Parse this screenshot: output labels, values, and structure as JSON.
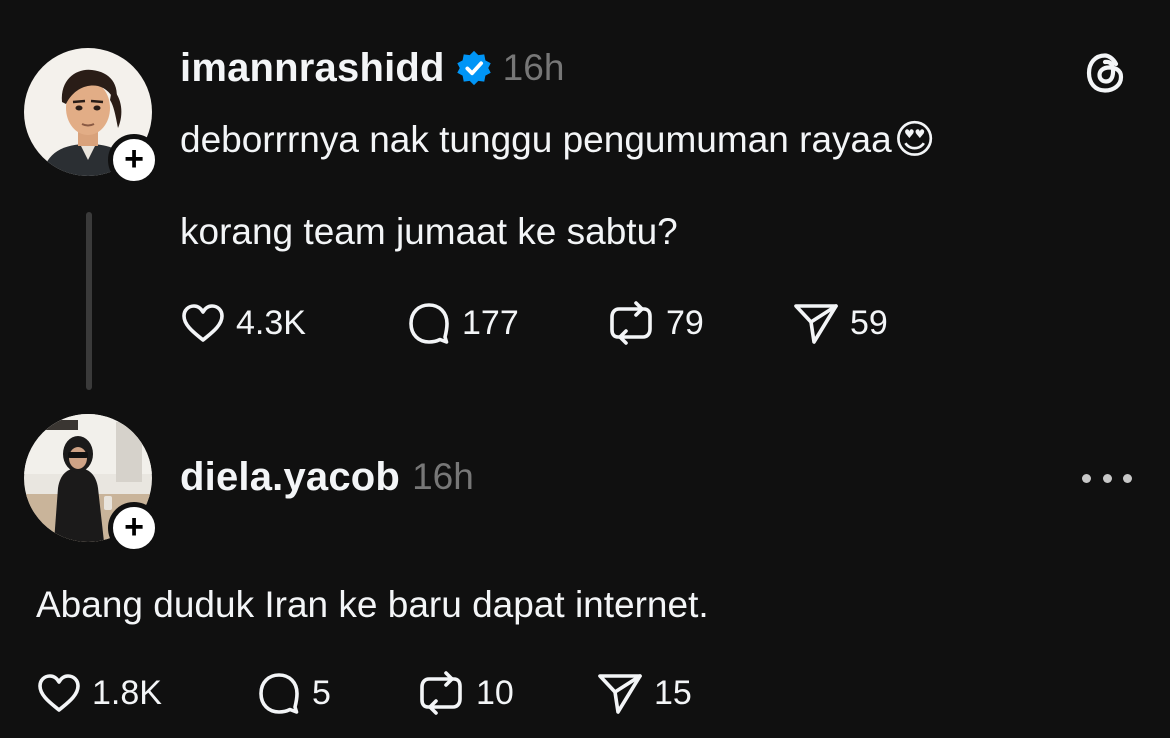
{
  "posts": [
    {
      "username": "imannrashidd",
      "verified": true,
      "timestamp": "16h",
      "text_lines": [
        "deborrrnya nak tunggu pengumuman rayaa",
        "korang team jumaat ke sabtu?"
      ],
      "emoji": "😍",
      "actions": {
        "likes": "4.3K",
        "replies": "177",
        "reposts": "79",
        "shares": "59"
      },
      "top_right_icon": "threads-logo-icon"
    },
    {
      "username": "diela.yacob",
      "verified": false,
      "timestamp": "16h",
      "text_lines": [
        "Abang duduk Iran ke baru dapat internet."
      ],
      "actions": {
        "likes": "1.8K",
        "replies": "5",
        "reposts": "10",
        "shares": "15"
      },
      "top_right_icon": "more-options-icon"
    }
  ],
  "colors": {
    "background": "#101010",
    "text": "#f3f5f7",
    "muted": "#777777",
    "verified": "#0095f6",
    "thread_line": "#3a3a3a"
  }
}
